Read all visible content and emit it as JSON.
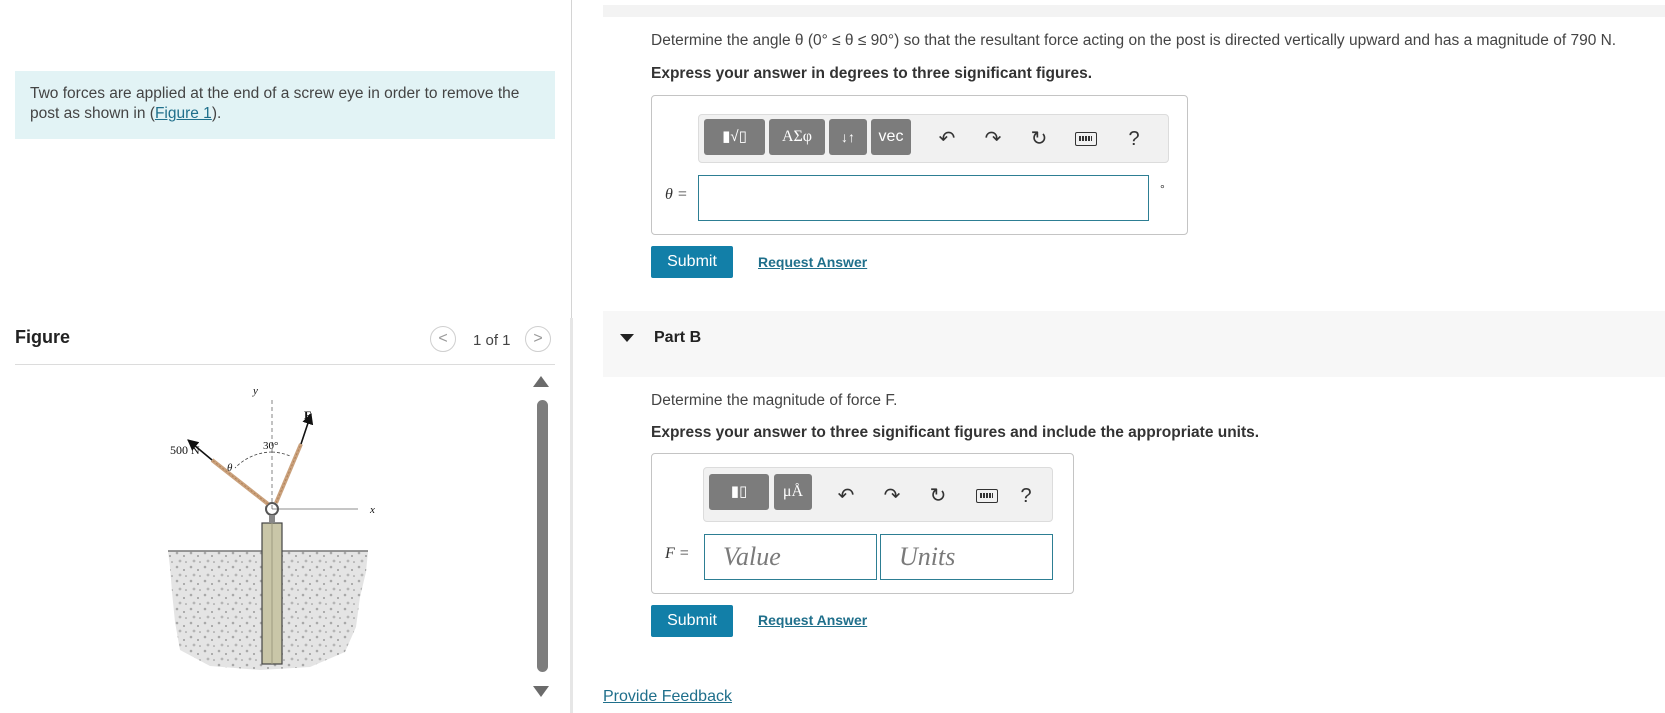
{
  "intro": {
    "text_before": "Two forces are applied at the end of a screw eye in order to remove the post as shown in (",
    "link": "Figure 1",
    "text_after": ")."
  },
  "figure": {
    "title": "Figure",
    "pager": "1 of 1",
    "prev_symbol": "<",
    "next_symbol": ">",
    "labels": {
      "force_left": "500 N",
      "angle_theta": "θ",
      "angle_30": "30°",
      "force_right": "F",
      "axis_y": "y",
      "axis_x": "x"
    }
  },
  "partA": {
    "prompt_text": "Determine the angle θ (0° ≤ θ ≤ 90°) so that the resultant force acting on the post is directed vertically upward and has a magnitude of 790 N.",
    "instruction": "Express your answer in degrees to three significant figures.",
    "toolbar": {
      "templates": "▮√▯",
      "greek": "ΑΣφ",
      "arrows": "↓↑",
      "vec": "vec",
      "help": "?"
    },
    "var_label": "θ =",
    "unit": "°",
    "input_value": "",
    "submit": "Submit",
    "request": "Request Answer"
  },
  "partB": {
    "title": "Part B",
    "prompt_text": "Determine the magnitude of force F.",
    "instruction": "Express your answer to three significant figures and include the appropriate units.",
    "toolbar": {
      "templates": "▮▯",
      "units": "μÅ",
      "help": "?"
    },
    "var_label": "F =",
    "value_placeholder": "Value",
    "units_placeholder": "Units",
    "submit": "Submit",
    "request": "Request Answer"
  },
  "footer": {
    "feedback": "Provide Feedback"
  },
  "icons": {
    "undo": "undo-icon",
    "redo": "redo-icon",
    "reset": "reset-icon",
    "keyboard": "keyboard-icon",
    "help": "help-icon"
  },
  "colors": {
    "accent": "#127fa8",
    "link": "#1f6f8b",
    "intro_bg": "#e2f3f5",
    "toolbar_btn": "#7c7c7c"
  }
}
